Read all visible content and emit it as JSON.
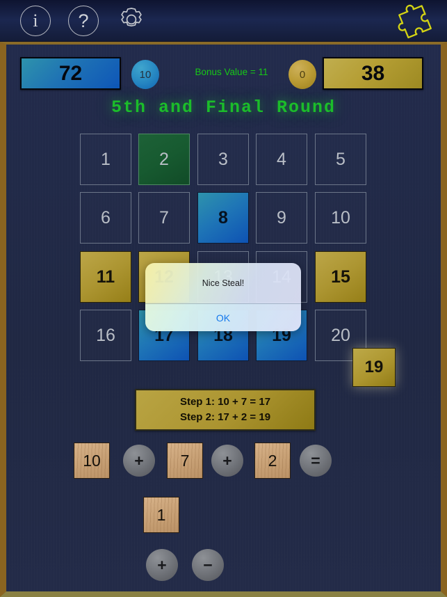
{
  "toolbar": {
    "info_icon": "info-icon",
    "info_label": "i",
    "help_icon": "help-icon",
    "help_label": "?",
    "gear_icon": "gear-icon",
    "puzzle_icon": "puzzle-piece-icon"
  },
  "scores": {
    "left_score": "72",
    "left_bubble": "10",
    "right_score": "38",
    "right_bubble": "0",
    "bonus_text": "Bonus Value = 11",
    "bonus_color": "#17c717",
    "left_color": "#1f73b4",
    "right_color": "#b59e34"
  },
  "round": {
    "title": "5th and Final Round"
  },
  "grid": {
    "tiles": [
      {
        "label": "1",
        "state": "plain"
      },
      {
        "label": "2",
        "state": "green"
      },
      {
        "label": "3",
        "state": "plain"
      },
      {
        "label": "4",
        "state": "plain"
      },
      {
        "label": "5",
        "state": "plain"
      },
      {
        "label": "6",
        "state": "plain"
      },
      {
        "label": "7",
        "state": "plain"
      },
      {
        "label": "8",
        "state": "blue"
      },
      {
        "label": "9",
        "state": "plain"
      },
      {
        "label": "10",
        "state": "plain"
      },
      {
        "label": "11",
        "state": "gold"
      },
      {
        "label": "12",
        "state": "gold"
      },
      {
        "label": "13",
        "state": "plain"
      },
      {
        "label": "14",
        "state": "plain"
      },
      {
        "label": "15",
        "state": "gold"
      },
      {
        "label": "16",
        "state": "plain"
      },
      {
        "label": "17",
        "state": "blue"
      },
      {
        "label": "18",
        "state": "blue"
      },
      {
        "label": "19",
        "state": "blue"
      },
      {
        "label": "20",
        "state": "plain"
      }
    ],
    "floating_tile": "19"
  },
  "steps": {
    "line1": "Step 1:  10 + 7 = 17",
    "line2": "Step 2:  17 + 2 = 19"
  },
  "equation": {
    "operand1": "10",
    "operator1": "+",
    "operand2": "7",
    "operator2": "+",
    "operand3": "2",
    "equals": "="
  },
  "second_row": {
    "value": "1"
  },
  "controls": {
    "plus": "+",
    "minus": "−"
  },
  "alert": {
    "message": "Nice Steal!",
    "ok_label": "OK"
  }
}
